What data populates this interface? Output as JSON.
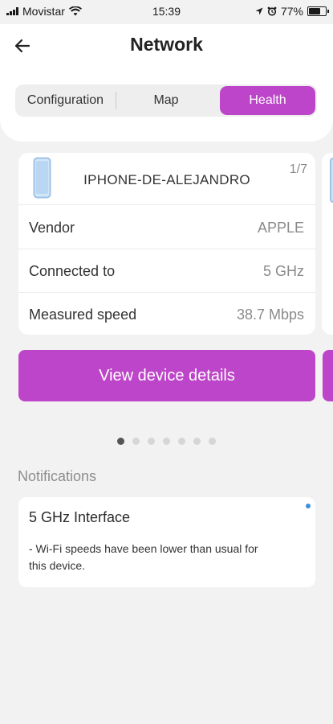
{
  "status_bar": {
    "carrier": "Movistar",
    "time": "15:39",
    "battery": "77%",
    "battery_level": 0.77,
    "icons": [
      "signal-icon",
      "wifi-icon",
      "location-arrow-icon",
      "alarm-icon",
      "battery-icon"
    ]
  },
  "header": {
    "title": "Network",
    "back_icon": "back-arrow-icon"
  },
  "tabs": [
    {
      "label": "Configuration",
      "active": false
    },
    {
      "label": "Map",
      "active": false
    },
    {
      "label": "Health",
      "active": true
    }
  ],
  "device_card": {
    "icon": "phone-icon",
    "name": "IPHONE-DE-ALEJANDRO",
    "index": "1/7",
    "rows": [
      {
        "label": "Vendor",
        "value": "APPLE"
      },
      {
        "label": "Connected to",
        "value": "5 GHz"
      },
      {
        "label": "Measured speed",
        "value": "38.7 Mbps"
      }
    ],
    "button_label": "View device details"
  },
  "pager": {
    "total": 7,
    "active_index": 0
  },
  "notifications": {
    "header": "Notifications",
    "items": [
      {
        "title": "5 GHz Interface",
        "body": "- Wi-Fi speeds have been lower than usual for this device.",
        "unread": true
      }
    ]
  },
  "colors": {
    "accent": "#bd45c9",
    "background": "#f2f2f2",
    "unread_dot": "#3b8fe0"
  }
}
